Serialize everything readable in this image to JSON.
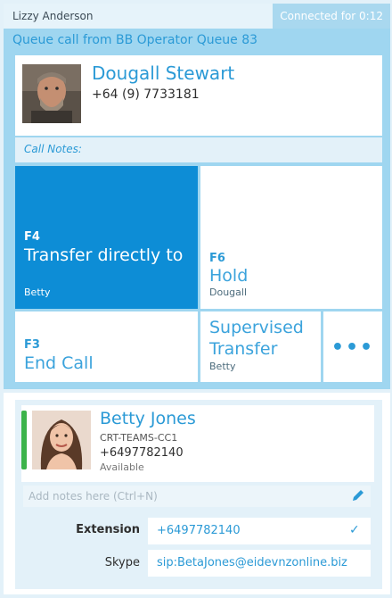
{
  "header": {
    "agent_name": "Lizzy Anderson",
    "connected": "Connected for 0:12"
  },
  "call": {
    "queue_label": "Queue call from BB Operator Queue 83",
    "caller_name": "Dougall Stewart",
    "caller_phone": "+64 (9) 7733181",
    "notes_label": "Call Notes:"
  },
  "actions": {
    "transfer": {
      "key": "F4",
      "label": "Transfer directly to",
      "sub": "Betty"
    },
    "hold": {
      "key": "F6",
      "label": "Hold",
      "sub": "Dougall"
    },
    "end_call": {
      "key": "F3",
      "label": "End Call"
    },
    "supervised": {
      "label": "Supervised Transfer",
      "sub": "Betty"
    },
    "more": {
      "label": "•••"
    }
  },
  "contact": {
    "name": "Betty Jones",
    "team": "CRT-TEAMS-CC1",
    "phone": "+6497782140",
    "status": "Available",
    "status_color": "#3cb34a",
    "notes_placeholder": "Add notes here (Ctrl+N)",
    "extension_label": "Extension",
    "extension_value": "+6497782140",
    "skype_label": "Skype",
    "skype_value": "sip:BetaJones@eidevnzonline.biz"
  },
  "icons": {
    "pencil": "pencil-icon",
    "check": "check-icon"
  },
  "colors": {
    "accent": "#2b9ad6",
    "primary_tile": "#0d8dd6",
    "panel": "#9fd6f0"
  }
}
